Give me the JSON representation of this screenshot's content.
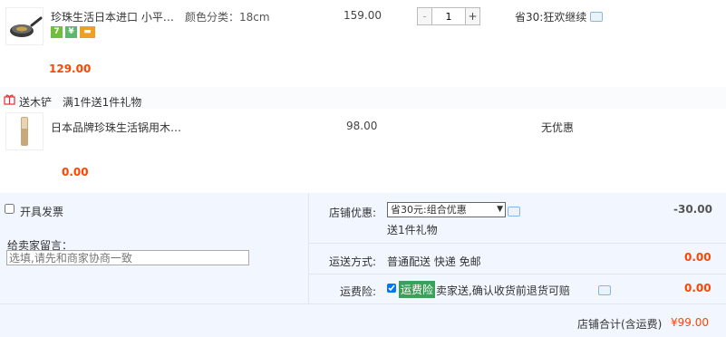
{
  "item1": {
    "title": "珍珠生活日本进口 小平…",
    "spec": "颜色分类：18cm",
    "price": "159.00",
    "qty": "1",
    "minus": "-",
    "plus": "+",
    "discount": "省30:狂欢继续",
    "subtotal": "129.00",
    "badges": [
      {
        "text": "7",
        "color": "#6fbf3d"
      },
      {
        "text": "¥",
        "color": "#5db86b"
      },
      {
        "text": "▬",
        "color": "#f0a020"
      }
    ]
  },
  "gift": {
    "tag": "送木铲",
    "rule": "满1件送1件礼物"
  },
  "item2": {
    "title": "日本品牌珍珠生活锅用木…",
    "price": "98.00",
    "discount": "无优惠",
    "subtotal": "0.00"
  },
  "order": {
    "invoice_label": "开具发票",
    "message_label": "给卖家留言：",
    "message_placeholder": "选填,请先和商家协商一致",
    "shop_discount_label": "店铺优惠:",
    "shop_discount_select": "省30元:组合优惠",
    "shop_discount_amount": "-30.00",
    "gift_note": "送1件礼物",
    "shipping_label": "运送方式:",
    "shipping_value": "普通配送 快递 免邮",
    "shipping_amount": "0.00",
    "insurance_label": "运费险:",
    "insurance_tag": "运费险",
    "insurance_text": "卖家送,确认收货前退货可赔",
    "insurance_amount": "0.00",
    "total_label": "店铺合计(含运费)",
    "total_amount": "¥99.00"
  }
}
